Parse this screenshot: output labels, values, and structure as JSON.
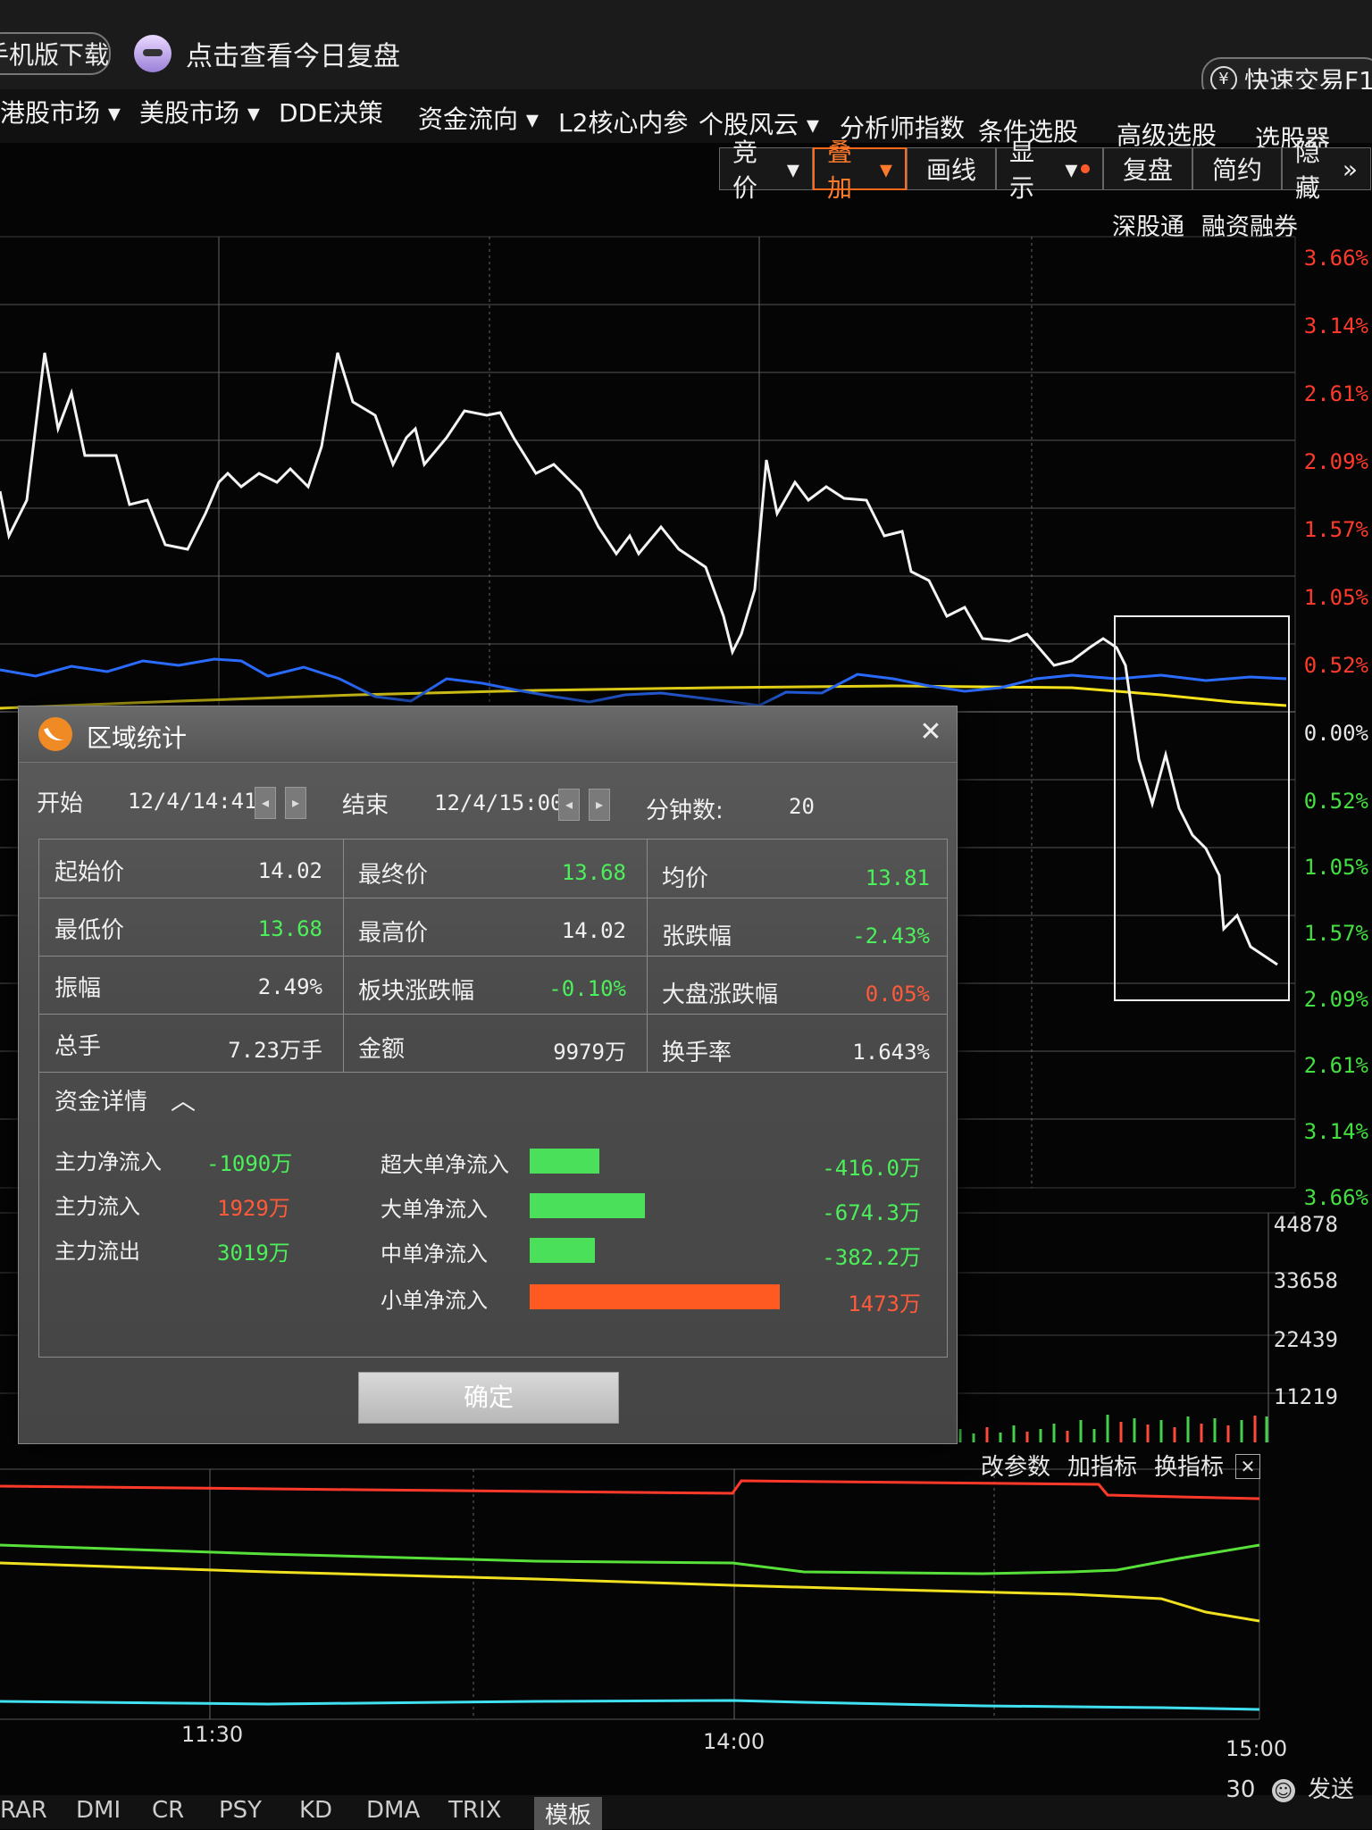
{
  "top": {
    "download_label": "手机版下载",
    "promo_text": "点击查看今日复盘",
    "quick_trade": "快速交易F1"
  },
  "menu": [
    "港股市场",
    "美股市场",
    "DDE决策",
    "资金流向",
    "L2核心内参",
    "个股风云",
    "分析师指数",
    "条件选股",
    "高级选股",
    "选股器"
  ],
  "toolbar": [
    "竞价",
    "叠加",
    "画线",
    "显示",
    "复盘",
    "简约",
    "隐藏"
  ],
  "sublinks": [
    "深股通",
    "融资融券"
  ],
  "price_axis": {
    "upper": [
      "3.66%",
      "3.14%",
      "2.61%",
      "2.09%",
      "1.57%",
      "1.05%",
      "0.52%"
    ],
    "zero": "0.00%",
    "lower": [
      "0.52%",
      "1.05%",
      "1.57%",
      "2.09%",
      "2.61%",
      "3.14%",
      "3.66%"
    ],
    "colors": {
      "up": "#ff3a2a",
      "zero": "#e8e8e8",
      "down": "#44e040"
    }
  },
  "volume_axis": [
    "44878",
    "33658",
    "22439",
    "11219"
  ],
  "time_axis": [
    "11:30",
    "14:00",
    "15:00"
  ],
  "dialog": {
    "title": "区域统计",
    "start_label": "开始",
    "start_value": "12/4/14:41",
    "end_label": "结束",
    "end_value": "12/4/15:00",
    "minutes_label": "分钟数:",
    "minutes_value": "20",
    "stats": [
      {
        "label": "起始价",
        "value": "14.02",
        "color": "#f0f0f0"
      },
      {
        "label": "最终价",
        "value": "13.68",
        "color": "#4bf05a"
      },
      {
        "label": "均价",
        "value": "13.81",
        "color": "#4bf05a"
      },
      {
        "label": "最低价",
        "value": "13.68",
        "color": "#4bf05a"
      },
      {
        "label": "最高价",
        "value": "14.02",
        "color": "#f0f0f0"
      },
      {
        "label": "张跌幅",
        "value": "-2.43%",
        "color": "#4bf05a"
      },
      {
        "label": "振幅",
        "value": "2.49%",
        "color": "#f0f0f0"
      },
      {
        "label": "板块涨跌幅",
        "value": "-0.10%",
        "color": "#4bf05a"
      },
      {
        "label": "大盘涨跌幅",
        "value": "0.05%",
        "color": "#ff5a3a"
      },
      {
        "label": "总手",
        "value": "7.23万手",
        "color": "#f0f0f0"
      },
      {
        "label": "金额",
        "value": "9979万",
        "color": "#f0f0f0"
      },
      {
        "label": "换手率",
        "value": "1.643%",
        "color": "#f0f0f0"
      }
    ],
    "fund_title": "资金详情",
    "main_flow": [
      {
        "label": "主力净流入",
        "value": "-1090万",
        "color": "#4bf05a"
      },
      {
        "label": "主力流入",
        "value": "1929万",
        "color": "#ff5a3a"
      },
      {
        "label": "主力流出",
        "value": "3019万",
        "color": "#4bf05a"
      }
    ],
    "order_flow": [
      {
        "label": "超大单净流入",
        "value": "-416.0万",
        "color": "#4bf05a",
        "bar_color": "#4be05a",
        "bar_fraction": 0.28
      },
      {
        "label": "大单净流入",
        "value": "-674.3万",
        "color": "#4bf05a",
        "bar_color": "#4be05a",
        "bar_fraction": 0.46
      },
      {
        "label": "中单净流入",
        "value": "-382.2万",
        "color": "#4bf05a",
        "bar_color": "#4be05a",
        "bar_fraction": 0.26
      },
      {
        "label": "小单净流入",
        "value": "1473万",
        "color": "#ff5a3a",
        "bar_color": "#ff5a22",
        "bar_fraction": 1.0
      }
    ],
    "ok_label": "确定"
  },
  "indicator_links": [
    "改参数",
    "加指标",
    "换指标"
  ],
  "bottom_tabs": [
    "RAR",
    "DMI",
    "CR",
    "PSY",
    "KD",
    "DMA",
    "TRIX",
    "模板"
  ],
  "bottom_right": {
    "count": "30",
    "send": "发送"
  }
}
